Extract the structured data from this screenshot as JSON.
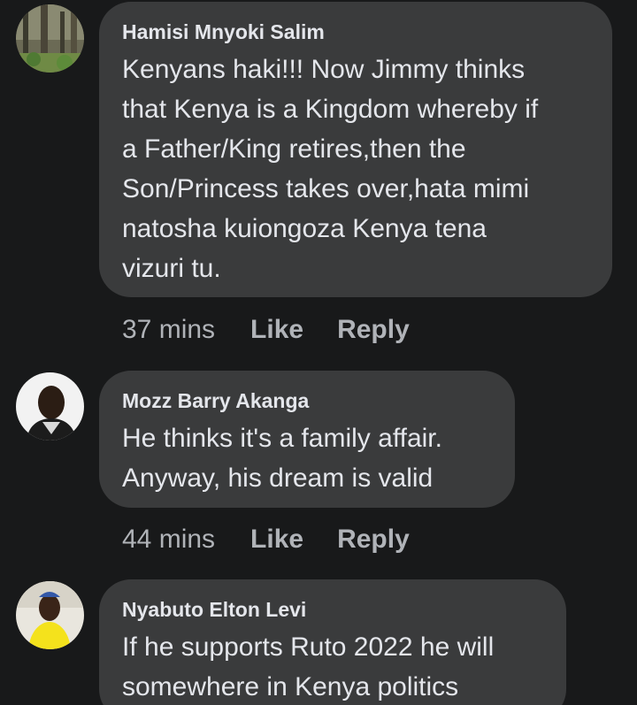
{
  "comments": [
    {
      "author": "Hamisi Mnyoki Salim",
      "lines": [
        "Kenyans haki!!! Now Jimmy thinks",
        "that Kenya is a Kingdom whereby if",
        "a Father/King retires,then the",
        "Son/Princess takes over,hata mimi",
        "natosha kuiongoza Kenya tena",
        "vizuri tu."
      ],
      "time": "37 mins",
      "like": "Like",
      "reply": "Reply"
    },
    {
      "author": "Mozz Barry Akanga",
      "lines": [
        "He thinks it's a family affair.",
        "Anyway, his dream is valid"
      ],
      "time": "44 mins",
      "like": "Like",
      "reply": "Reply"
    },
    {
      "author": "Nyabuto Elton Levi",
      "lines": [
        "If he supports Ruto 2022 he will",
        "somewhere in Kenya politics"
      ]
    }
  ]
}
